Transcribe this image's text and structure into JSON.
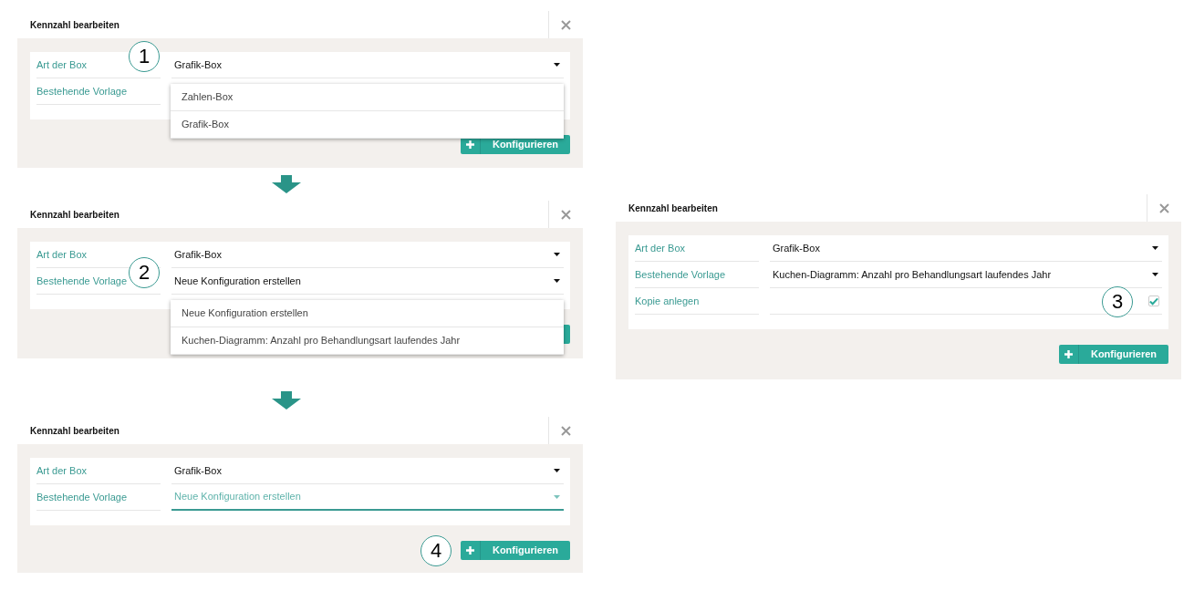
{
  "panels": [
    {
      "title": "Kennzahl bearbeiten",
      "rows": [
        {
          "kind": "select",
          "label": "Art der Box",
          "value": "Grafik-Box",
          "focused": false,
          "callout": "1",
          "open": true,
          "options": [
            {
              "label": "Zahlen-Box"
            },
            {
              "label": "Grafik-Box"
            }
          ]
        },
        {
          "kind": "select",
          "label": "Bestehende Vorlage"
        }
      ],
      "button": {
        "label": "Konfigurieren"
      }
    },
    {
      "title": "Kennzahl bearbeiten",
      "rows": [
        {
          "kind": "select",
          "label": "Art der Box",
          "value": "Grafik-Box",
          "focused": false
        },
        {
          "kind": "select",
          "label": "Bestehende Vorlage",
          "value": "Neue Konfiguration erstellen",
          "focused": false,
          "callout": "2",
          "open": true,
          "options": [
            {
              "label": "Neue Konfiguration erstellen"
            },
            {
              "label": "Kuchen-Diagramm: Anzahl pro Behandlungsart laufendes Jahr"
            }
          ]
        }
      ],
      "button_edge": true
    },
    {
      "title": "Kennzahl bearbeiten",
      "rows": [
        {
          "kind": "select",
          "label": "Art der Box",
          "value": "Grafik-Box",
          "focused": false
        },
        {
          "kind": "select",
          "label": "Bestehende Vorlage",
          "placeholder": "Neue Konfiguration erstellen",
          "focused": true
        }
      ],
      "button": {
        "label": "Konfigurieren",
        "callout": "4"
      }
    },
    {
      "title": "Kennzahl bearbeiten",
      "rows": [
        {
          "kind": "select",
          "label": "Art der Box",
          "value": "Grafik-Box",
          "focused": false
        },
        {
          "kind": "select",
          "label": "Bestehende Vorlage",
          "value": "Kuchen-Diagramm: Anzahl pro Behandlungsart laufendes Jahr",
          "focused": false
        },
        {
          "kind": "checkbox",
          "label": "Kopie anlegen",
          "checked": true,
          "callout": "3"
        }
      ],
      "button": {
        "label": "Konfigurieren"
      }
    }
  ]
}
